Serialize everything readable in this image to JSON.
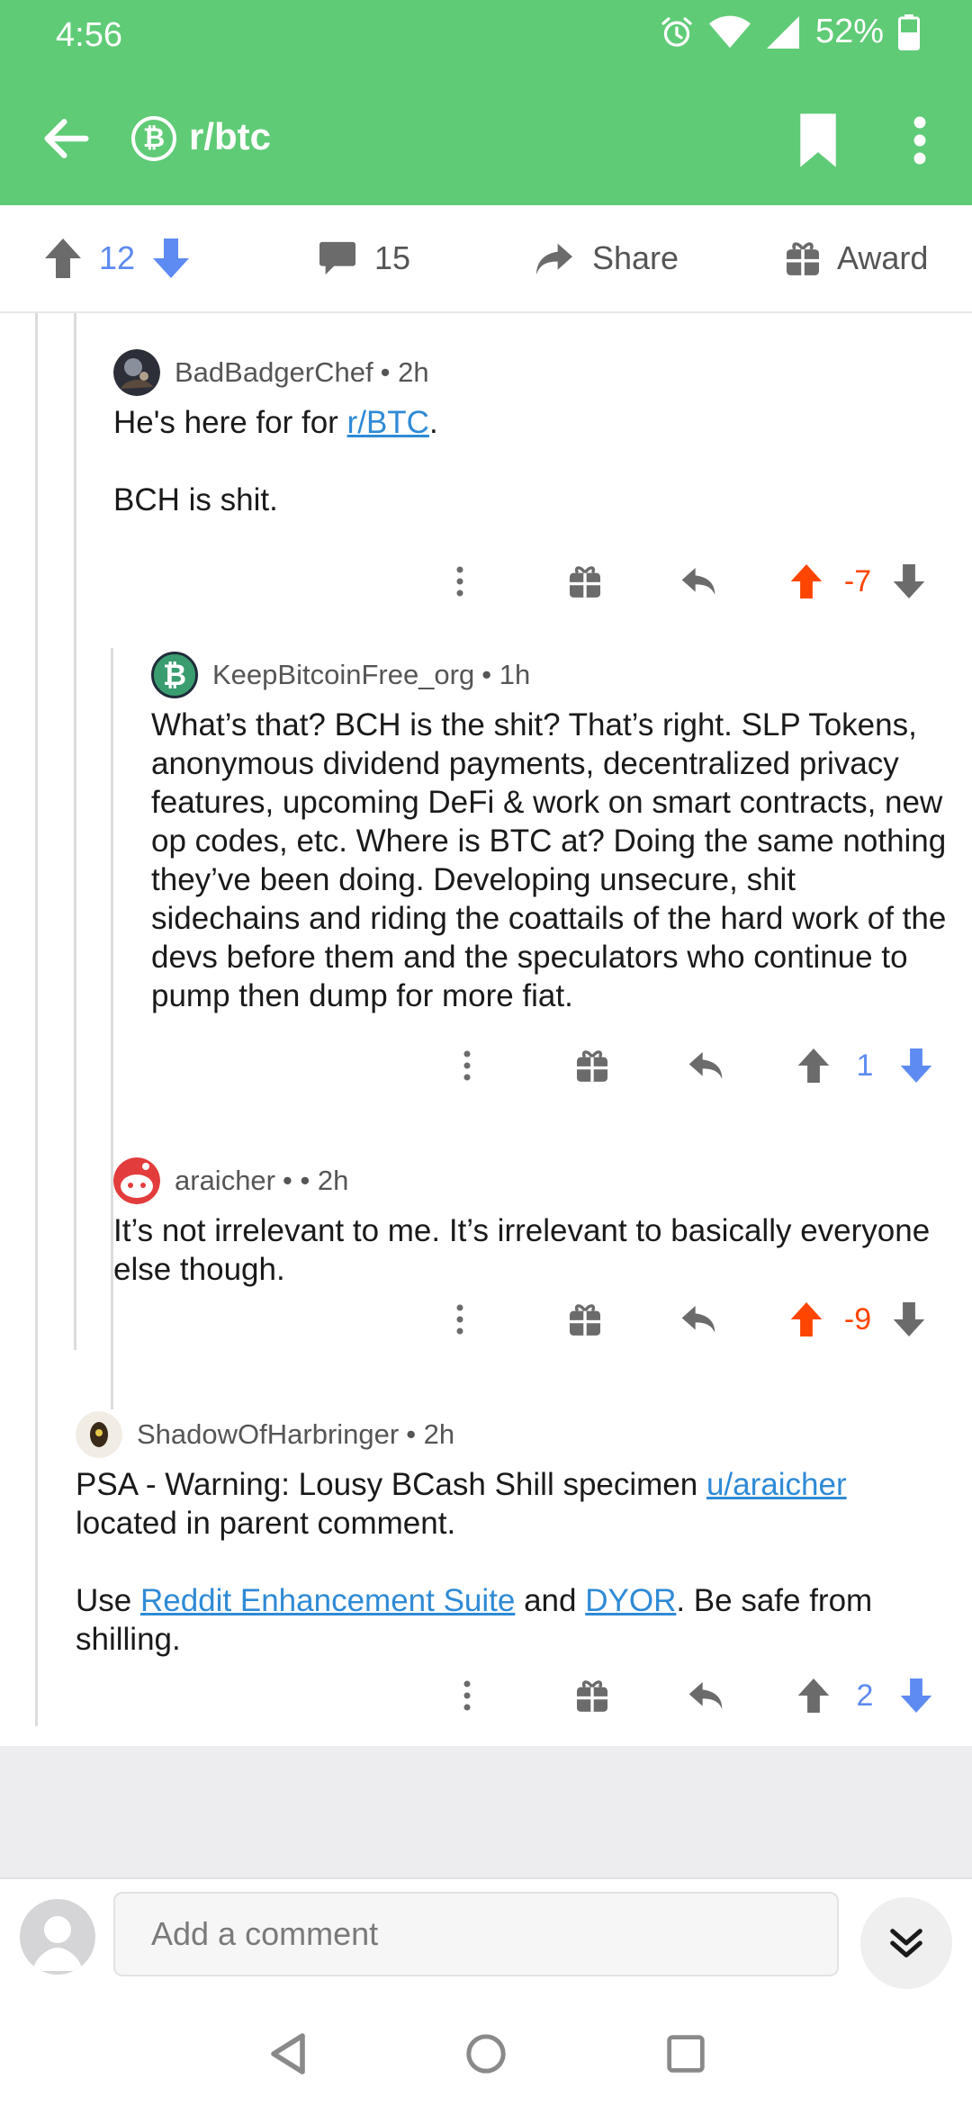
{
  "status": {
    "time": "4:56",
    "battery": "52%"
  },
  "app_bar": {
    "sub_icon_glyph": "₿",
    "subreddit": "r/btc"
  },
  "post_actions": {
    "vote_score": "12",
    "comments_count": "15",
    "share_label": "Share",
    "award_label": "Award"
  },
  "comments": [
    {
      "author": "BadBadgerChef",
      "meta": "• 2h",
      "body_1_prefix": "He's here for for ",
      "body_1_link": "r/BTC",
      "body_1_suffix": ".",
      "body_2": "BCH is shit.",
      "score": "-7"
    },
    {
      "author": "KeepBitcoinFree_org",
      "avatar_glyph": "₿",
      "meta": "• 1h",
      "body": "What’s that? BCH is the shit? That’s right. SLP Tokens, anonymous dividend payments, decentralized privacy features, upcoming DeFi & work on smart contracts, new op codes, etc. Where is BTC at? Doing the same nothing they’ve been doing. Developing unsecure, shit sidechains and riding the coattails of the hard work of the devs before them and the speculators who continue to pump then dump for more fiat.",
      "score": "1"
    },
    {
      "author": "araicher",
      "meta": "•  • 2h",
      "body": "It’s not irrelevant to me. It’s irrelevant to basically everyone else though.",
      "score": "-9"
    },
    {
      "author": "ShadowOfHarbringer",
      "meta": "• 2h",
      "body_1_prefix": "PSA - Warning: Lousy BCash Shill specimen ",
      "body_1_link": "u/araicher",
      "body_1_suffix": " located in parent comment.",
      "body_2_prefix": "Use ",
      "body_2_link1": "Reddit Enhancement Suite",
      "body_2_mid": " and ",
      "body_2_link2": "DYOR",
      "body_2_suffix": ". Be safe from shilling.",
      "score": "2"
    }
  ],
  "composer": {
    "placeholder": "Add a comment"
  },
  "colors": {
    "header": "#5fcb76",
    "upvote_active": "#ff4500",
    "downvote_active": "#5e8bf2",
    "link": "#2f8ad6",
    "bch_green": "#3a9d6f"
  }
}
